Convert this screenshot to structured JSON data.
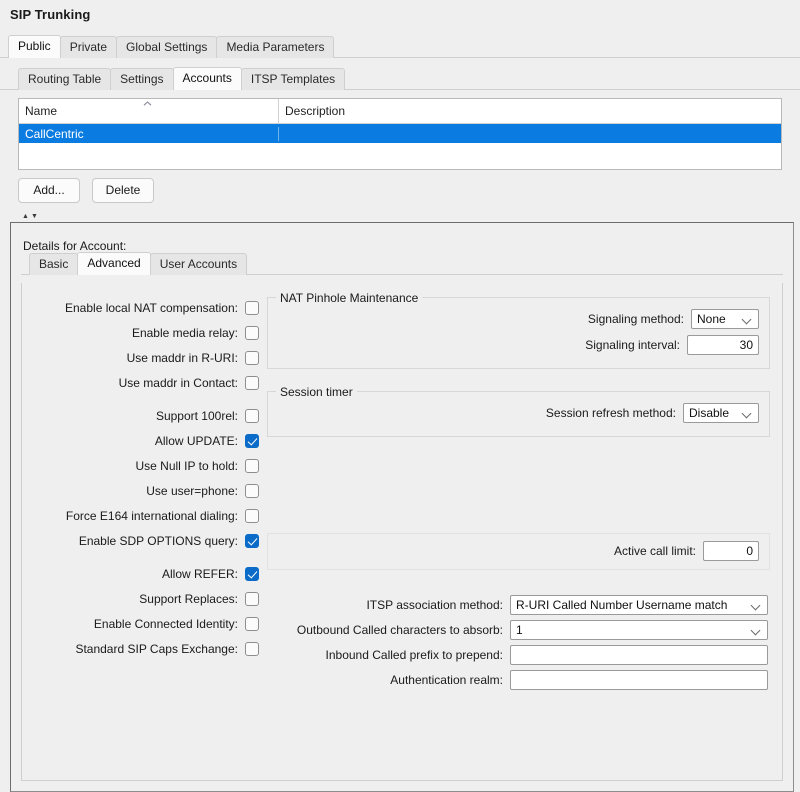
{
  "page_title": "SIP Trunking",
  "outer_tabs": [
    {
      "label": "Public",
      "active": true
    },
    {
      "label": "Private",
      "active": false
    },
    {
      "label": "Global Settings",
      "active": false
    },
    {
      "label": "Media Parameters",
      "active": false
    }
  ],
  "inner_tabs": [
    {
      "label": "Routing Table",
      "active": false
    },
    {
      "label": "Settings",
      "active": false
    },
    {
      "label": "Accounts",
      "active": true
    },
    {
      "label": "ITSP Templates",
      "active": false
    }
  ],
  "accounts_table": {
    "columns": [
      "Name",
      "Description"
    ],
    "sort_caret": "▲",
    "rows": [
      {
        "name": "CallCentric",
        "description": "",
        "selected": true
      }
    ]
  },
  "buttons": {
    "add": "Add...",
    "delete": "Delete"
  },
  "splitter": {
    "up": "▲",
    "down": "▼"
  },
  "details": {
    "title": "Details for Account:",
    "tabs": [
      {
        "label": "Basic",
        "active": false
      },
      {
        "label": "Advanced",
        "active": true
      },
      {
        "label": "User Accounts",
        "active": false
      }
    ]
  },
  "checkboxes": [
    {
      "label": "Enable local NAT compensation:",
      "checked": false
    },
    {
      "label": "Enable media relay:",
      "checked": false
    },
    {
      "label": "Use maddr in R-URI:",
      "checked": false
    },
    {
      "label": "Use maddr in Contact:",
      "checked": false
    },
    {
      "label": "Support 100rel:",
      "checked": false
    },
    {
      "label": "Allow UPDATE:",
      "checked": true
    },
    {
      "label": "Use Null IP to hold:",
      "checked": false
    },
    {
      "label": "Use user=phone:",
      "checked": false
    },
    {
      "label": "Force E164 international dialing:",
      "checked": false
    },
    {
      "label": "Enable SDP OPTIONS query:",
      "checked": true
    },
    {
      "label": "Allow REFER:",
      "checked": true
    },
    {
      "label": "Support Replaces:",
      "checked": false
    },
    {
      "label": "Enable Connected Identity:",
      "checked": false
    },
    {
      "label": "Standard SIP Caps Exchange:",
      "checked": false
    }
  ],
  "nat_pinhole": {
    "legend": "NAT Pinhole Maintenance",
    "signaling_method_label": "Signaling method:",
    "signaling_method_value": "None",
    "signaling_interval_label": "Signaling interval:",
    "signaling_interval_value": "30"
  },
  "session_timer": {
    "legend": "Session timer",
    "refresh_method_label": "Session refresh method:",
    "refresh_method_value": "Disable"
  },
  "active_call_limit": {
    "label": "Active call limit:",
    "value": "0"
  },
  "bottom_fields": {
    "itsp_label": "ITSP association method:",
    "itsp_value": "R-URI Called Number Username match",
    "absorb_label": "Outbound Called characters to absorb:",
    "absorb_value": "1",
    "prefix_label": "Inbound Called prefix to prepend:",
    "prefix_value": "",
    "realm_label": "Authentication realm:",
    "realm_value": ""
  },
  "colors": {
    "selection_blue": "#0a7be0",
    "checkbox_blue": "#0a6cc8",
    "background": "#efefef"
  }
}
